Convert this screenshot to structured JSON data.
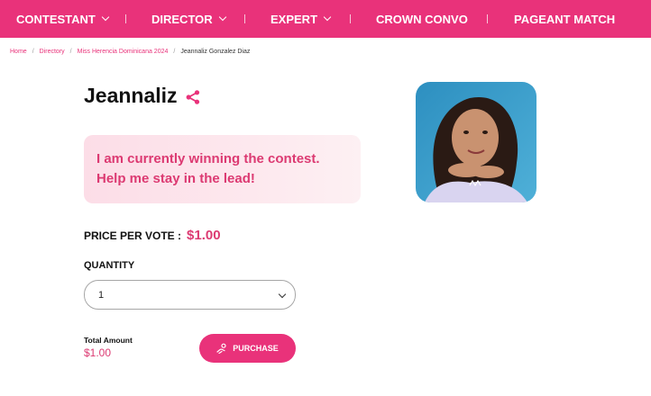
{
  "nav": {
    "items": [
      {
        "label": "CONTESTANT",
        "has_dropdown": true
      },
      {
        "label": "DIRECTOR",
        "has_dropdown": true
      },
      {
        "label": "EXPERT",
        "has_dropdown": true
      },
      {
        "label": "CROWN CONVO",
        "has_dropdown": false
      },
      {
        "label": "PAGEANT MATCH",
        "has_dropdown": false
      }
    ]
  },
  "breadcrumb": {
    "items": [
      "Home",
      "Directory",
      "Miss Herencia Dominicana 2024",
      "Jeannaliz Gonzalez Diaz"
    ]
  },
  "profile": {
    "name": "Jeannaliz",
    "promo_message": "I am currently winning the contest. Help me stay in the lead!"
  },
  "vote": {
    "price_label": "PRICE PER VOTE :",
    "price_value": "$1.00",
    "quantity_label": "QUANTITY",
    "quantity_value": "1",
    "total_label": "Total Amount",
    "total_value": "$1.00",
    "purchase_label": "PURCHASE"
  },
  "colors": {
    "brand": "#e9327a",
    "promo_text": "#dc3a72"
  },
  "icons": {
    "share": "share-icon",
    "purchase": "hand-coins-icon",
    "dropdown": "chevron-down-icon"
  }
}
